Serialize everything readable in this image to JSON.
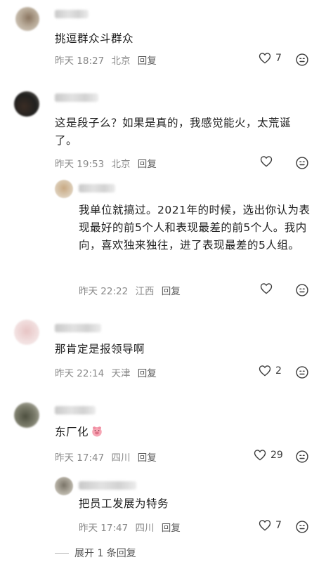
{
  "comments": [
    {
      "text": "挑逗群众斗群众",
      "meta": {
        "time": "昨天 18:27",
        "location": "北京",
        "reply": "回复"
      },
      "likes": "7"
    },
    {
      "text": "这是段子么？如果是真的，我感觉能火，太荒诞了。",
      "meta": {
        "time": "昨天 19:53",
        "location": "北京",
        "reply": "回复"
      },
      "likes": ""
    },
    {
      "text": "我单位就搞过。2021年的时候，选出你认为表现最好的前5个人和表现最差的前5个人。我内向，喜欢独来独往，进了表现最差的5人组。",
      "meta": {
        "time": "昨天 22:22",
        "location": "江西",
        "reply": "回复"
      },
      "likes": ""
    },
    {
      "text": "那肯定是报领导啊",
      "meta": {
        "time": "昨天 22:14",
        "location": "天津",
        "reply": "回复"
      },
      "likes": "2"
    },
    {
      "text": "东厂化",
      "emoji": "pig-face-icon",
      "meta": {
        "time": "昨天 17:47",
        "location": "四川",
        "reply": "回复"
      },
      "likes": "29"
    },
    {
      "text": "把员工发展为特务",
      "meta": {
        "time": "昨天 17:47",
        "location": "四川",
        "reply": "回复"
      },
      "likes": "7"
    }
  ],
  "expand_replies": "展开 1 条回复",
  "colors": {
    "text": "#1e1e1e",
    "meta": "#8a8a8a",
    "icon": "#3a3a3a"
  }
}
